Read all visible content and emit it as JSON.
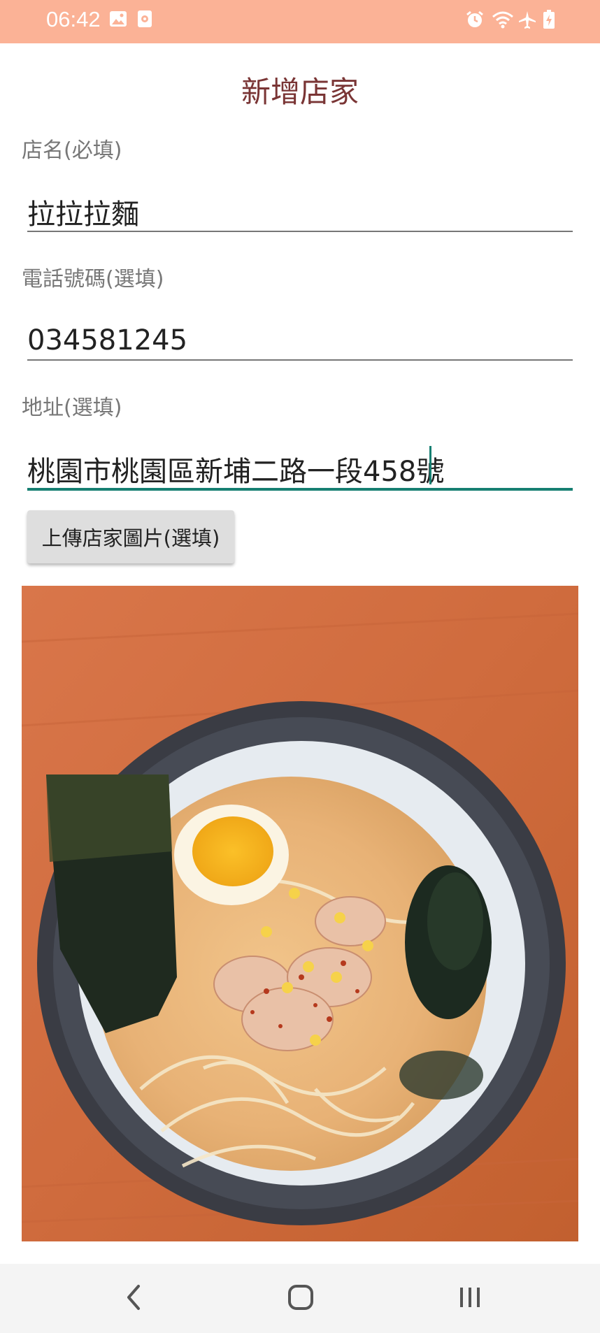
{
  "status_bar": {
    "time": "06:42",
    "left_icons": [
      "image-icon",
      "recording-icon"
    ],
    "right_icons": [
      "alarm-icon",
      "wifi-icon",
      "airplane-mode-icon",
      "battery-charging-icon"
    ],
    "background_color": "#fbb296"
  },
  "page": {
    "title": "新增店家"
  },
  "form": {
    "name_label": "店名(必填)",
    "name_value": "拉拉拉麵",
    "phone_label": "電話號碼(選填)",
    "phone_value": "034581245",
    "address_label": "地址(選填)",
    "address_value": "桃園市桃園區新埔二路一段458號",
    "upload_button_label": "上傳店家圖片(選填)"
  },
  "image": {
    "subject": "ramen-bowl-photo"
  },
  "nav_bar": {
    "icons": [
      "back-icon",
      "home-icon",
      "recent-apps-icon"
    ]
  },
  "colors": {
    "accent": "#167f72",
    "title": "#7a3535",
    "label": "#777777"
  }
}
